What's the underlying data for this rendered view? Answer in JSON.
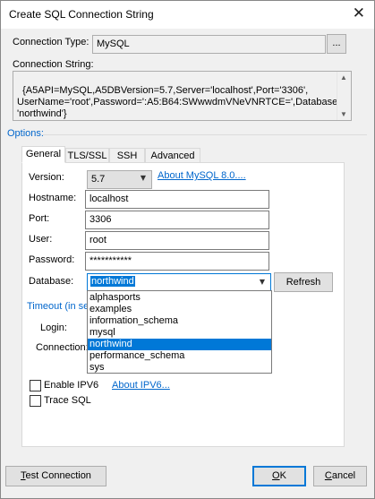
{
  "window": {
    "title": "Create SQL Connection String",
    "close_glyph": "✕"
  },
  "connection_type": {
    "label": "Connection Type:",
    "value": "MySQL",
    "browse_label": "..."
  },
  "connection_string": {
    "label": "Connection String:",
    "value": "{A5API=MySQL,A5DBVersion=5.7,Server='localhost',Port='3306',\nUserName='root',Password=':A5:B64:SWwwdmVNeVNRTCE=',Database=\n'northwind'}"
  },
  "options": {
    "label": "Options:",
    "tabs": [
      {
        "label": "General",
        "active": true
      },
      {
        "label": "TLS/SSL",
        "active": false
      },
      {
        "label": "SSH",
        "active": false
      },
      {
        "label": "Advanced",
        "active": false
      }
    ]
  },
  "general": {
    "version_label": "Version:",
    "version_value": "5.7",
    "about_mysql_link": "About MySQL 8.0....",
    "hostname_label": "Hostname:",
    "hostname_value": "localhost",
    "port_label": "Port:",
    "port_value": "3306",
    "user_label": "User:",
    "user_value": "root",
    "password_label": "Password:",
    "password_value": "***********",
    "database_label": "Database:",
    "database_value": "northwind",
    "refresh_label": "Refresh",
    "database_options": [
      "alphasports",
      "examples",
      "information_schema",
      "mysql",
      "northwind",
      "performance_schema",
      "sys"
    ],
    "database_selected_index": 4
  },
  "timeout": {
    "legend": "Timeout (in se",
    "login_label": "Login:",
    "connection_label": "Connection:"
  },
  "checks": {
    "ipv6_label": "Enable IPV6",
    "ipv6_checked": false,
    "about_ipv6_link": "About IPV6...",
    "trace_label": "Trace SQL",
    "trace_checked": false
  },
  "footer": {
    "test_prefix": "T",
    "test_rest": "est Connection",
    "ok_prefix": "O",
    "ok_rest": "K",
    "cancel_prefix": "C",
    "cancel_rest": "ancel"
  },
  "colors": {
    "accent": "#0078d7",
    "link": "#0066cc",
    "window_bg": "#f0f0f0"
  }
}
